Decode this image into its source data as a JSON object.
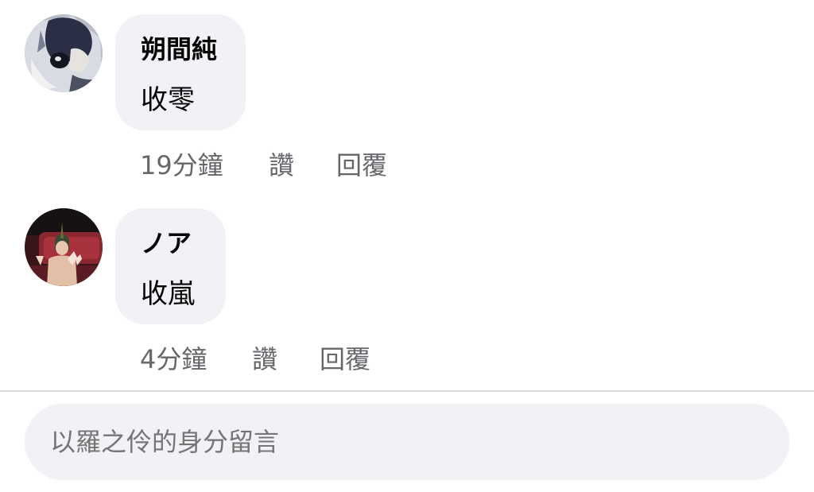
{
  "comments": [
    {
      "author": "朔間純",
      "text": "收零",
      "time": "19分鐘",
      "like_label": "讚",
      "reply_label": "回覆"
    },
    {
      "author": "ノア",
      "text": "收嵐",
      "time": "4分鐘",
      "like_label": "讚",
      "reply_label": "回覆"
    }
  ],
  "composer": {
    "placeholder": "以羅之伶的身分留言"
  },
  "colors": {
    "bubble": "#f0f2f5",
    "secondary_text": "#65676b",
    "primary_text": "#050505",
    "divider": "#d8dadf"
  }
}
